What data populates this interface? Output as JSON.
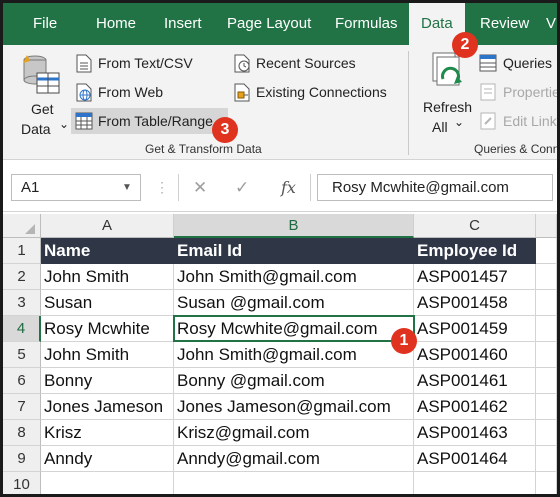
{
  "ribbon_tabs": [
    "File",
    "Home",
    "Insert",
    "Page Layout",
    "Formulas",
    "Data",
    "Review",
    "V"
  ],
  "active_tab": "Data",
  "get_data": {
    "line1": "Get",
    "line2": "Data",
    "caret": "⌄"
  },
  "commands": {
    "from_text_csv": "From Text/CSV",
    "from_web": "From Web",
    "from_table_range": "From Table/Range",
    "recent_sources": "Recent Sources",
    "existing_connections": "Existing Connections"
  },
  "group_get_transform": "Get & Transform Data",
  "refresh": {
    "line1": "Refresh",
    "line2": "All",
    "caret": "⌄"
  },
  "queries": {
    "queries": "Queries",
    "properties": "Properties",
    "edit_links": "Edit Links"
  },
  "group_queries": "Queries & Connections",
  "callouts": [
    "1",
    "2",
    "3"
  ],
  "name_box": "A1",
  "formula_bar": {
    "cancel": "✕",
    "enter": "✓",
    "fx": "fx",
    "value": "Rosy Mcwhite@gmail.com"
  },
  "columns": [
    "A",
    "B",
    "C"
  ],
  "rows": [
    "1",
    "2",
    "3",
    "4",
    "5",
    "6",
    "7",
    "8",
    "9",
    "10"
  ],
  "table": {
    "headers": [
      "Name",
      "Email Id",
      "Employee Id"
    ],
    "data": [
      [
        "John Smith",
        "John Smith@gmail.com",
        "ASP001457"
      ],
      [
        "Susan",
        "Susan @gmail.com",
        "ASP001458"
      ],
      [
        "Rosy Mcwhite",
        "Rosy Mcwhite@gmail.com",
        "ASP001459"
      ],
      [
        "John Smith",
        "John Smith@gmail.com",
        "ASP001460"
      ],
      [
        "Bonny",
        "Bonny @gmail.com",
        "ASP001461"
      ],
      [
        "Jones Jameson",
        "Jones Jameson@gmail.com",
        "ASP001462"
      ],
      [
        "Krisz",
        "Krisz@gmail.com",
        "ASP001463"
      ],
      [
        "Anndy",
        "Anndy@gmail.com",
        "ASP001464"
      ]
    ]
  },
  "colors": {
    "excel_green": "#217346",
    "header_fill": "#2f3747",
    "callout_red": "#e0331f"
  }
}
